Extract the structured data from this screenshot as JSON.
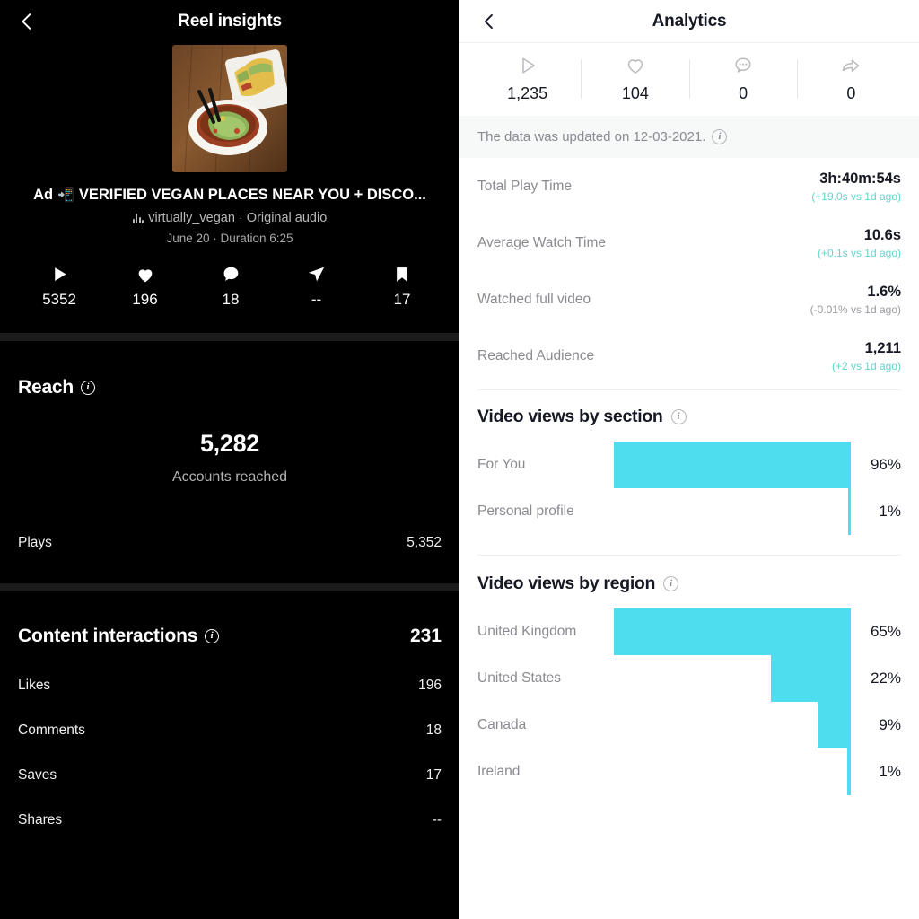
{
  "left_panel": {
    "header": {
      "title": "Reel insights",
      "back_icon": "chevron-left-icon"
    },
    "post": {
      "ad_label": "Ad",
      "ad_emoji": "📲",
      "caption": "VERIFIED VEGAN PLACES NEAR YOU + DISCO...",
      "audio": "virtually_vegan · Original audio",
      "meta": "June 20 · Duration 6:25"
    },
    "stats": [
      {
        "icon": "play-icon",
        "value": "5352"
      },
      {
        "icon": "heart-icon",
        "value": "196"
      },
      {
        "icon": "comment-icon",
        "value": "18"
      },
      {
        "icon": "share-icon",
        "value": "--"
      },
      {
        "icon": "bookmark-icon",
        "value": "17"
      }
    ],
    "reach": {
      "title": "Reach",
      "info_icon": "info-icon",
      "big_number": "5,282",
      "big_label": "Accounts reached",
      "rows": [
        {
          "label": "Plays",
          "value": "5,352"
        }
      ]
    },
    "interactions": {
      "title": "Content interactions",
      "info_icon": "info-icon",
      "total": "231",
      "rows": [
        {
          "label": "Likes",
          "value": "196"
        },
        {
          "label": "Comments",
          "value": "18"
        },
        {
          "label": "Saves",
          "value": "17"
        },
        {
          "label": "Shares",
          "value": "--"
        }
      ]
    }
  },
  "right_panel": {
    "header": {
      "title": "Analytics",
      "back_icon": "chevron-left-icon"
    },
    "stats": [
      {
        "icon": "play-outline-icon",
        "value": "1,235"
      },
      {
        "icon": "heart-outline-icon",
        "value": "104"
      },
      {
        "icon": "comment-outline-icon",
        "value": "0"
      },
      {
        "icon": "share-outline-icon",
        "value": "0"
      }
    ],
    "banner": {
      "text": "The data was updated on 12-03-2021.",
      "info_icon": "info-icon"
    },
    "metrics": [
      {
        "label": "Total Play Time",
        "value": "3h:40m:54s",
        "delta": "(+19.0s vs 1d ago)",
        "direction": "up"
      },
      {
        "label": "Average Watch Time",
        "value": "10.6s",
        "delta": "(+0.1s vs 1d ago)",
        "direction": "up"
      },
      {
        "label": "Watched full video",
        "value": "1.6%",
        "delta": "(-0.01% vs 1d ago)",
        "direction": "down"
      },
      {
        "label": "Reached Audience",
        "value": "1,211",
        "delta": "(+2 vs 1d ago)",
        "direction": "up"
      }
    ],
    "accent_color": "#4edcef",
    "delta_up_color": "#62d4cd",
    "delta_down_color": "#9a9ba0"
  },
  "chart_data": [
    {
      "type": "bar",
      "title": "Video views by section",
      "orientation": "horizontal-right-aligned",
      "categories": [
        "For You",
        "Personal profile"
      ],
      "values": [
        96,
        1
      ],
      "value_labels": [
        "96%",
        "1%"
      ],
      "unit": "%",
      "xlabel": "",
      "ylabel": "",
      "xlim": [
        0,
        100
      ],
      "grid": false,
      "legend": "none",
      "bar_color": "#4edcef"
    },
    {
      "type": "bar",
      "title": "Video views by region",
      "orientation": "horizontal-right-aligned",
      "categories": [
        "United Kingdom",
        "United States",
        "Canada",
        "Ireland"
      ],
      "values": [
        65,
        22,
        9,
        1
      ],
      "value_labels": [
        "65%",
        "22%",
        "9%",
        "1%"
      ],
      "unit": "%",
      "xlabel": "",
      "ylabel": "",
      "xlim": [
        0,
        100
      ],
      "grid": false,
      "legend": "none",
      "bar_color": "#4edcef"
    }
  ]
}
